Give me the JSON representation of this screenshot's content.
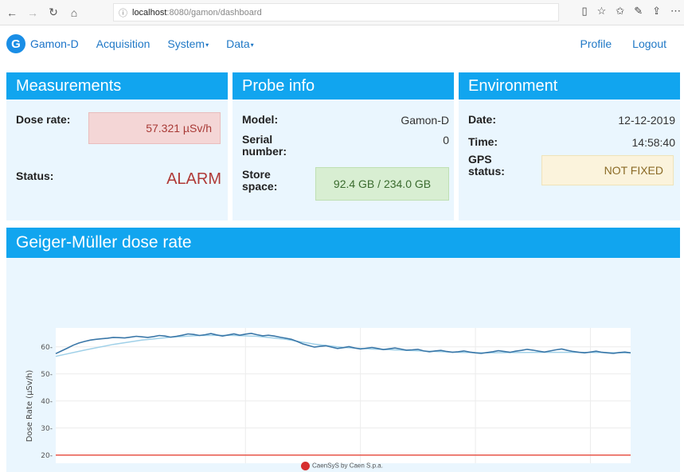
{
  "browser": {
    "url_host": "localhost",
    "url_path": ":8080/gamon/dashboard"
  },
  "navbar": {
    "brand": "Gamon-D",
    "links": [
      "Acquisition",
      "System",
      "Data"
    ],
    "right_links": [
      "Profile",
      "Logout"
    ]
  },
  "measurements": {
    "title": "Measurements",
    "dose_rate_label": "Dose rate:",
    "dose_rate_value": "57.321 µSv/h",
    "status_label": "Status:",
    "status_value": "ALARM"
  },
  "probe": {
    "title": "Probe info",
    "model_label": "Model:",
    "model_value": "Gamon-D",
    "serial_label": "Serial number:",
    "serial_value": "0",
    "store_label": "Store space:",
    "store_value": "92.4 GB / 234.0 GB"
  },
  "environment": {
    "title": "Environment",
    "date_label": "Date:",
    "date_value": "12-12-2019",
    "time_label": "Time:",
    "time_value": "14:58:40",
    "gps_label": "GPS status:",
    "gps_value": "NOT FIXED"
  },
  "chart_panel": {
    "title": "Geiger-Müller dose rate"
  },
  "footer": {
    "text": "CaenSyS by Caen S.p.a."
  },
  "colors": {
    "accent": "#11a5ef",
    "panel_bg": "#eaf6fe",
    "series": "#3a77a8",
    "trend": "#9fd0e8",
    "threshold": "#e8554a"
  },
  "chart_data": {
    "type": "line",
    "title": "",
    "xlabel": "",
    "ylabel": "Dose Rate (µSv/h)",
    "y_ticks": [
      20,
      30,
      40,
      50,
      60
    ],
    "ylim": [
      17,
      67
    ],
    "x_range": [
      0,
      100
    ],
    "series": [
      {
        "values": [
          57.5,
          58.5,
          59.5,
          60.6,
          61.4,
          62.0,
          62.5,
          62.8,
          63.0,
          63.2,
          63.5,
          63.4,
          63.3,
          63.6,
          63.9,
          63.7,
          63.5,
          63.8,
          64.2,
          64.0,
          63.6,
          63.9,
          64.3,
          64.8,
          64.6,
          64.2,
          64.5,
          64.9,
          64.4,
          64.0,
          64.4,
          64.8,
          64.3,
          64.7,
          65.0,
          64.5,
          64.1,
          64.3,
          64.0,
          63.6,
          63.2,
          62.8,
          62.0,
          61.1,
          60.5,
          59.9,
          60.2,
          60.4,
          59.9,
          59.4,
          59.7,
          60.1,
          59.6,
          59.2,
          59.5,
          59.8,
          59.4,
          59.0,
          59.3,
          59.6,
          59.2,
          58.8,
          58.9,
          59.1,
          58.5,
          58.2,
          58.5,
          58.7,
          58.3,
          58.0,
          58.2,
          58.5,
          58.1,
          57.8,
          57.6,
          57.9,
          58.2,
          58.6,
          58.3,
          58.0,
          58.4,
          58.7,
          59.1,
          58.8,
          58.4,
          58.1,
          58.5,
          58.9,
          59.2,
          58.7,
          58.3,
          58.0,
          57.8,
          58.1,
          58.4,
          58.0,
          57.8,
          57.6,
          57.9,
          58.1,
          57.8
        ]
      }
    ],
    "trend_values": [
      56.5,
      58.8,
      60.9,
      62.5,
      63.6,
      64.2,
      64.3,
      63.9,
      62.8,
      61.0,
      59.8,
      59.2,
      58.8,
      58.4,
      58.0,
      57.8,
      57.9,
      58.0,
      58.0,
      57.9,
      57.8
    ],
    "threshold": 20,
    "grid": true
  }
}
